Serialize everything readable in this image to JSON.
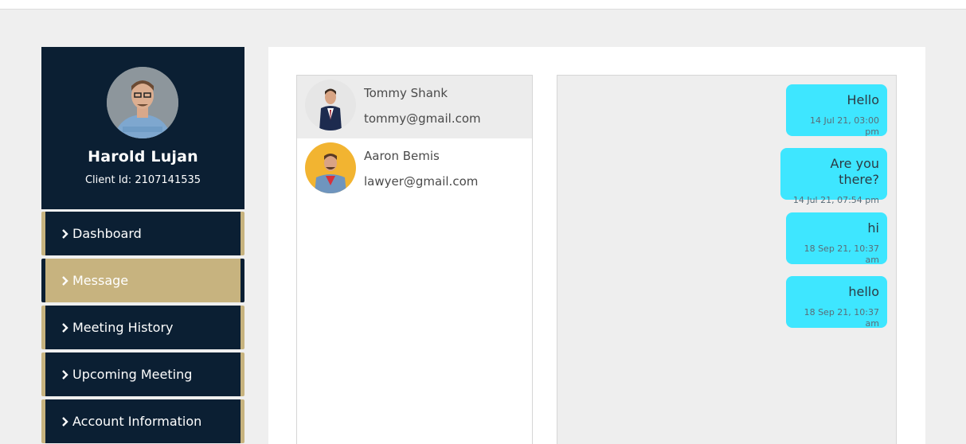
{
  "profile": {
    "name": "Harold Lujan",
    "client_id": "Client Id: 2107141535"
  },
  "menu": [
    {
      "label": "Dashboard",
      "active": false
    },
    {
      "label": "Message",
      "active": true
    },
    {
      "label": "Meeting History",
      "active": false
    },
    {
      "label": "Upcoming Meeting",
      "active": false
    },
    {
      "label": "Account Information",
      "active": false
    }
  ],
  "contacts": [
    {
      "name": "Tommy Shank",
      "email": "tommy@gmail.com",
      "selected": true
    },
    {
      "name": "Aaron Bemis",
      "email": "lawyer@gmail.com",
      "selected": false
    }
  ],
  "messages": [
    {
      "text": "Hello",
      "time": "14 Jul 21, 03:00 pm"
    },
    {
      "text": "Are you there?",
      "time": "14 Jul 21, 07:54 pm"
    },
    {
      "text": "hi",
      "time": "18 Sep 21, 10:37 am"
    },
    {
      "text": "hello",
      "time": "18 Sep 21, 10:37 am"
    }
  ],
  "colors": {
    "sidebar_navy": "#0b1f33",
    "accent_gold": "#c7b37f",
    "bubble_cyan": "#3ee6ff",
    "page_bg": "#efefef"
  },
  "icons": {
    "menu_chevron": "chevron-right-icon"
  }
}
